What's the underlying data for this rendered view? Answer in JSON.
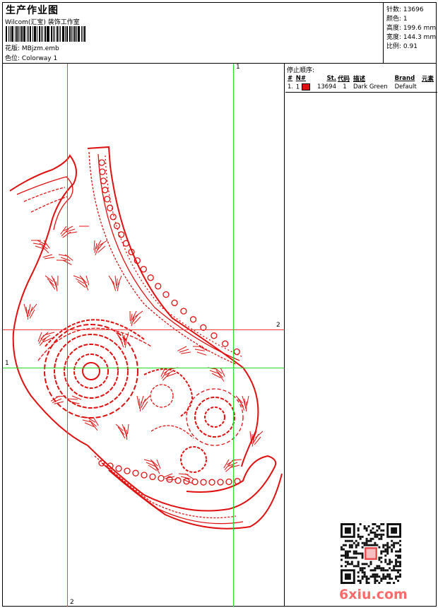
{
  "header": {
    "title": "生产作业图",
    "subtitle": "Wilcom(汇宝) 装饰工作室",
    "design_label": "花版:",
    "design_value": "MBjzm.emb",
    "colorway_label": "色位:",
    "colorway_value": "Colorway 1"
  },
  "stats": [
    {
      "label": "针数:",
      "value": "13696"
    },
    {
      "label": "颜色:",
      "value": "1"
    },
    {
      "label": "高度:",
      "value": "199.6 mm"
    },
    {
      "label": "宽度:",
      "value": "144.3 mm"
    },
    {
      "label": "比例:",
      "value": "0.91"
    }
  ],
  "guides": {
    "red_v_label": "2",
    "red_h_label": "2",
    "green_v_label": "1",
    "green_h_label": "1"
  },
  "stop_sequence": {
    "title": "停止顺序:",
    "columns": [
      "#",
      "N#",
      "St.",
      "代码",
      "描述",
      "Brand",
      "元素"
    ],
    "rows": [
      {
        "num": "1.",
        "needle": "1",
        "stitches": "13694",
        "code": "1",
        "description": "Dark Green",
        "brand": "Default",
        "element": ""
      }
    ]
  },
  "colors": {
    "thread": "#e01010",
    "guide_red": "#ff3a3a",
    "guide_green": "#22dd22",
    "watermark": "#ff6a6a"
  },
  "watermark": "6xiu.com"
}
